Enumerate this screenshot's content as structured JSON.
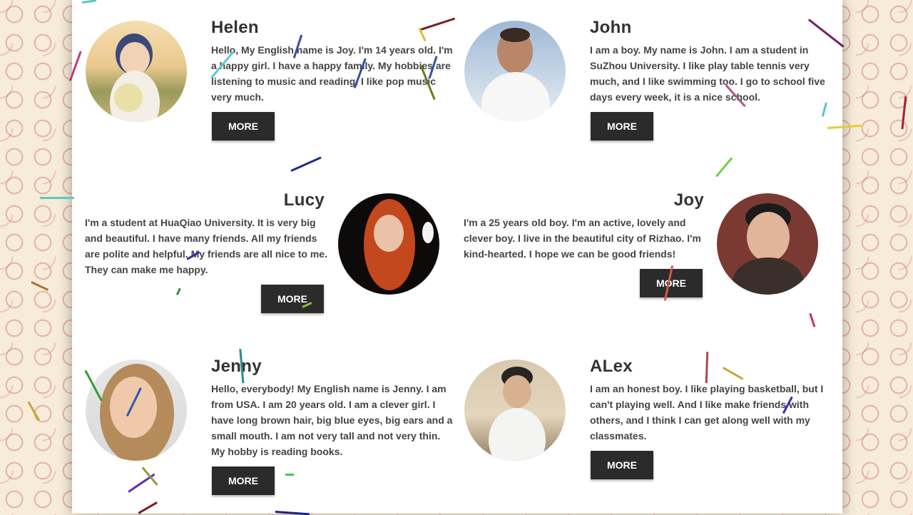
{
  "profiles": [
    {
      "name": "Helen",
      "text": "Hello, My English name is Joy. I'm 14 years old. I'm a happy girl. I have a happy family. My hobbies are listening to music and reading. I like pop music very much.",
      "button": "MORE"
    },
    {
      "name": "John",
      "text": "I am a boy. My name is John. I am a student in SuZhou University. I like play table tennis very much, and I like swimming too. I go to school five days every week, it is a nice school.",
      "button": "MORE"
    },
    {
      "name": "Lucy",
      "text": "I'm a student at HuaQiao University. It is very big and beautiful. I have many friends. All my friends are polite and helpful. My friends are all nice to me. They can make me happy.",
      "button": "MORE"
    },
    {
      "name": "Joy",
      "text": "I'm a 25 years old boy. I'm an active, lovely and clever boy. I live in the beautiful city of Rizhao. I'm kind-hearted. I hope we can be good friends!",
      "button": "MORE"
    },
    {
      "name": "Jenny",
      "text": "Hello, everybody! My English name is Jenny. I am from USA. I am 20 years old. I am a clever girl. I have long brown hair, big blue eyes, big ears and a small mouth. I am not very tall and not very thin. My hobby is reading books.",
      "button": "MORE"
    },
    {
      "name": "ALex",
      "text": "I am an honest boy. I like playing basketball, but I can't playing well. And I like make friends with others, and I think I can get along well with my classmates.",
      "button": "MORE"
    }
  ]
}
